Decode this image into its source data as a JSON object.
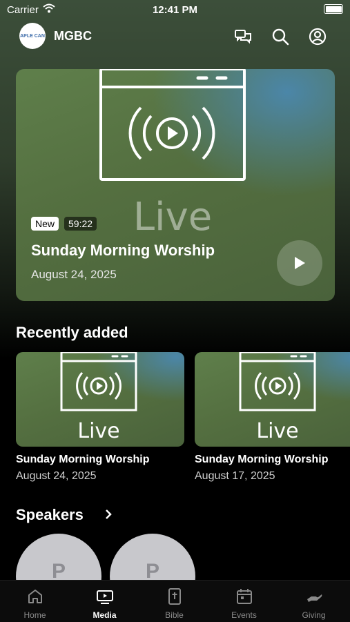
{
  "status_bar": {
    "carrier": "Carrier",
    "time": "12:41 PM"
  },
  "header": {
    "logo_text": "APLE CAN",
    "app_name": "MGBC",
    "icons": [
      "chat-bubbles-icon",
      "search-icon",
      "account-icon"
    ]
  },
  "featured": {
    "badge_new": "New",
    "duration": "59:22",
    "title": "Sunday Morning Worship",
    "date": "August 24, 2025",
    "thumbnail_text": "Live"
  },
  "recently_added": {
    "title": "Recently added",
    "items": [
      {
        "title": "Sunday Morning Worship",
        "date": "August 24, 2025",
        "thumbnail_text": "Live"
      },
      {
        "title": "Sunday Morning Worship",
        "date": "August 17, 2025",
        "thumbnail_text": "Live"
      }
    ]
  },
  "speakers": {
    "title": "Speakers",
    "items": [
      {
        "initial": "P"
      },
      {
        "initial": "P"
      }
    ]
  },
  "tabs": [
    {
      "label": "Home",
      "icon": "home-icon"
    },
    {
      "label": "Media",
      "icon": "tv-play-icon",
      "active": true
    },
    {
      "label": "Bible",
      "icon": "bible-icon"
    },
    {
      "label": "Events",
      "icon": "calendar-icon"
    },
    {
      "label": "Giving",
      "icon": "giving-hand-icon"
    }
  ],
  "colors": {
    "background": "#000000",
    "header_tint": "#3c4f3a",
    "tab_active": "#ffffff",
    "tab_inactive": "#8a8a8a"
  }
}
